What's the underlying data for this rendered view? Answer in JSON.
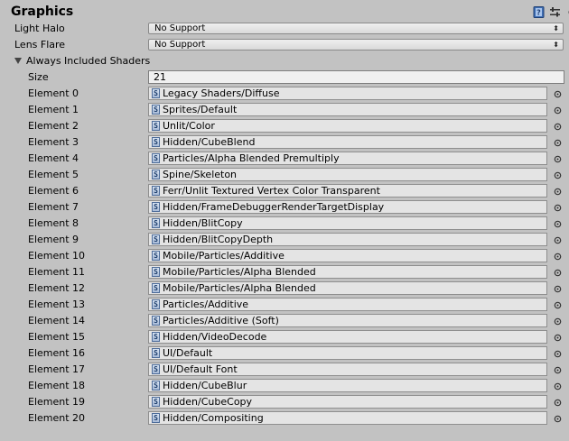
{
  "header": {
    "title": "Graphics",
    "icons": [
      "help-icon",
      "preset-icon",
      "gear-icon"
    ]
  },
  "light_halo": {
    "label": "Light Halo",
    "value": "No Support"
  },
  "lens_flare": {
    "label": "Lens Flare",
    "value": "No Support"
  },
  "shaders": {
    "foldout_label": "Always Included Shaders",
    "size_label": "Size",
    "size_value": "21",
    "elements": [
      {
        "label": "Element 0",
        "value": "Legacy Shaders/Diffuse"
      },
      {
        "label": "Element 1",
        "value": "Sprites/Default"
      },
      {
        "label": "Element 2",
        "value": "Unlit/Color"
      },
      {
        "label": "Element 3",
        "value": "Hidden/CubeBlend"
      },
      {
        "label": "Element 4",
        "value": "Particles/Alpha Blended Premultiply"
      },
      {
        "label": "Element 5",
        "value": "Spine/Skeleton"
      },
      {
        "label": "Element 6",
        "value": "Ferr/Unlit Textured Vertex Color Transparent"
      },
      {
        "label": "Element 7",
        "value": "Hidden/FrameDebuggerRenderTargetDisplay"
      },
      {
        "label": "Element 8",
        "value": "Hidden/BlitCopy"
      },
      {
        "label": "Element 9",
        "value": "Hidden/BlitCopyDepth"
      },
      {
        "label": "Element 10",
        "value": "Mobile/Particles/Additive"
      },
      {
        "label": "Element 11",
        "value": "Mobile/Particles/Alpha Blended"
      },
      {
        "label": "Element 12",
        "value": "Mobile/Particles/Alpha Blended"
      },
      {
        "label": "Element 13",
        "value": "Particles/Additive"
      },
      {
        "label": "Element 14",
        "value": "Particles/Additive (Soft)"
      },
      {
        "label": "Element 15",
        "value": "Hidden/VideoDecode"
      },
      {
        "label": "Element 16",
        "value": "UI/Default"
      },
      {
        "label": "Element 17",
        "value": "UI/Default Font"
      },
      {
        "label": "Element 18",
        "value": "Hidden/CubeBlur"
      },
      {
        "label": "Element 19",
        "value": "Hidden/CubeCopy"
      },
      {
        "label": "Element 20",
        "value": "Hidden/Compositing"
      }
    ]
  },
  "colors": {
    "background": "#c2c2c2",
    "field_bg": "#e4e4e4",
    "shader_icon": "#4d6c99"
  }
}
